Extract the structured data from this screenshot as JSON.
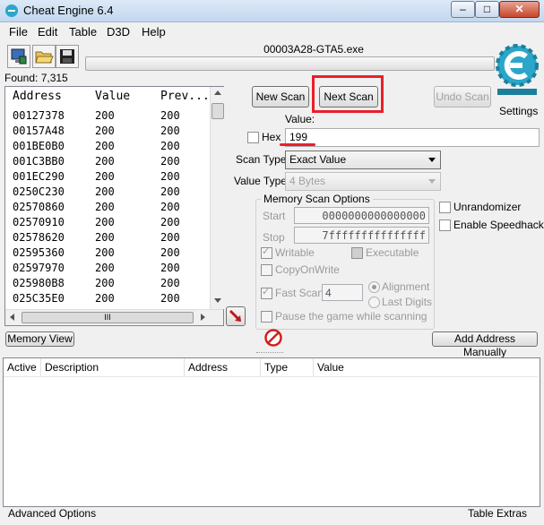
{
  "window": {
    "title": "Cheat Engine 6.4",
    "min": "–",
    "max": "□",
    "close": "✕"
  },
  "menu": [
    "File",
    "Edit",
    "Table",
    "D3D",
    "Help"
  ],
  "process": "00003A28-GTA5.exe",
  "found": "Found: 7,315",
  "results": {
    "headers": [
      "Address",
      "Value",
      "Prev..."
    ],
    "rows": [
      [
        "00127378",
        "200",
        "200"
      ],
      [
        "00157A48",
        "200",
        "200"
      ],
      [
        "001BE0B0",
        "200",
        "200"
      ],
      [
        "001C3BB0",
        "200",
        "200"
      ],
      [
        "001EC290",
        "200",
        "200"
      ],
      [
        "0250C230",
        "200",
        "200"
      ],
      [
        "02570860",
        "200",
        "200"
      ],
      [
        "02570910",
        "200",
        "200"
      ],
      [
        "02578620",
        "200",
        "200"
      ],
      [
        "02595360",
        "200",
        "200"
      ],
      [
        "02597970",
        "200",
        "200"
      ],
      [
        "025980B8",
        "200",
        "200"
      ],
      [
        "025C35E0",
        "200",
        "200"
      ]
    ],
    "hscroll_grip": "III"
  },
  "scan": {
    "new_scan": "New Scan",
    "next_scan": "Next Scan",
    "undo_scan": "Undo Scan",
    "settings": "Settings",
    "value_label": "Value:",
    "hex_label": "Hex",
    "value": "199",
    "scan_type_label": "Scan Type",
    "scan_type": "Exact Value",
    "value_type_label": "Value Type",
    "value_type": "4 Bytes",
    "memory_options_label": "Memory Scan Options",
    "start_label": "Start",
    "start_value": "0000000000000000",
    "stop_label": "Stop",
    "stop_value": "7fffffffffffffff",
    "writable": "Writable",
    "executable": "Executable",
    "copyonwrite": "CopyOnWrite",
    "fast_scan": "Fast Scan",
    "fast_scan_value": "4",
    "alignment": "Alignment",
    "last_digits": "Last Digits",
    "pause": "Pause the game while scanning",
    "unrandomizer": "Unrandomizer",
    "speedhack": "Enable Speedhack"
  },
  "memory_view": "Memory View",
  "add_address": "Add Address Manually",
  "address_table": {
    "headers": [
      "Active",
      "Description",
      "Address",
      "Type",
      "Value"
    ]
  },
  "footer": {
    "advanced": "Advanced Options",
    "extras": "Table Extras"
  },
  "logo_text": "Cheat Engine",
  "colors": {
    "highlight": "#e8202a",
    "logo": "#2aa6c9"
  }
}
